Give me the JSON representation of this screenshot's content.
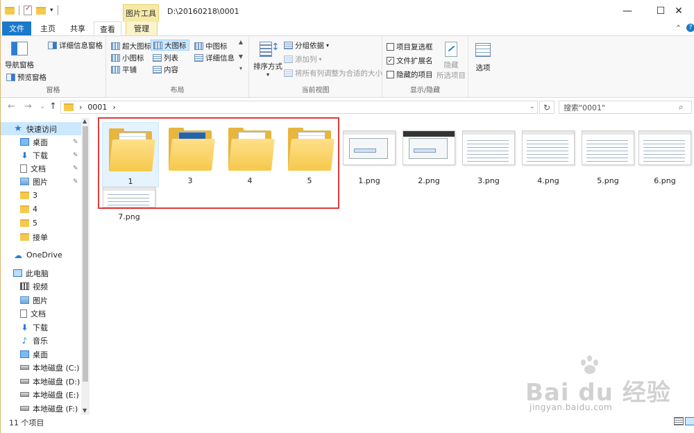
{
  "titlebar": {
    "context_tab": "图片工具",
    "path": "D:\\20160218\\0001",
    "minimize": "—",
    "maximize": "☐",
    "close": "✕"
  },
  "tabs": {
    "file": "文件",
    "home": "主页",
    "share": "共享",
    "view": "查看",
    "manage": "管理",
    "collapse": "⌃",
    "help": "?"
  },
  "ribbon": {
    "pane": {
      "nav_pane": "导航窗格",
      "preview_pane": "预览窗格",
      "details_pane": "详细信息窗格",
      "label": "窗格"
    },
    "layout": {
      "items": [
        "超大图标",
        "大图标",
        "中图标",
        "小图标",
        "列表",
        "详细信息",
        "平铺",
        "内容"
      ],
      "selected": "大图标",
      "label": "布局"
    },
    "current_view": {
      "sort_by": "排序方式",
      "group_by": "分组依据",
      "add_columns": "添加列",
      "fit_columns": "将所有列调整为合适的大小",
      "label": "当前视图"
    },
    "show_hide": {
      "item_checkboxes": "项目复选框",
      "item_checkboxes_checked": false,
      "file_extensions": "文件扩展名",
      "file_extensions_checked": true,
      "hidden_items": "隐藏的项目",
      "hidden_items_checked": false,
      "hide": "隐藏",
      "hide_selected": "所选项目",
      "label": "显示/隐藏"
    },
    "options": {
      "label": "选项"
    }
  },
  "navbar": {
    "back": "←",
    "forward": "→",
    "recent": "⌄",
    "up": "↑",
    "crumb_sep": "›",
    "crumb": "0001",
    "search_placeholder": "搜索\"0001\"",
    "search_icon": "⌕",
    "refresh": "↻",
    "dropdown": "⌄"
  },
  "sidebar": {
    "quick_access": "快速访问",
    "desktop": "桌面",
    "downloads": "下载",
    "documents": "文档",
    "pictures": "图片",
    "folder_3": "3",
    "folder_4": "4",
    "folder_5": "5",
    "jiedan": "接单",
    "onedrive": "OneDrive",
    "this_pc": "此电脑",
    "videos": "视频",
    "pc_pictures": "图片",
    "pc_documents": "文档",
    "pc_downloads": "下载",
    "music": "音乐",
    "pc_desktop": "桌面",
    "drive_c": "本地磁盘 (C:)",
    "drive_d": "本地磁盘 (D:)",
    "drive_e": "本地磁盘 (E:)",
    "drive_f": "本地磁盘 (F:)",
    "pin": "✎"
  },
  "files": {
    "f1": "1",
    "f3": "3",
    "f4": "4",
    "f5": "5",
    "p1": "1.png",
    "p2": "2.png",
    "p3": "3.png",
    "p4": "4.png",
    "p5": "5.png",
    "p6": "6.png",
    "p7": "7.png"
  },
  "status": {
    "count": "11 个项目"
  },
  "watermark": {
    "brand": "Bai du 经验",
    "url": "jingyan.baidu.com"
  }
}
